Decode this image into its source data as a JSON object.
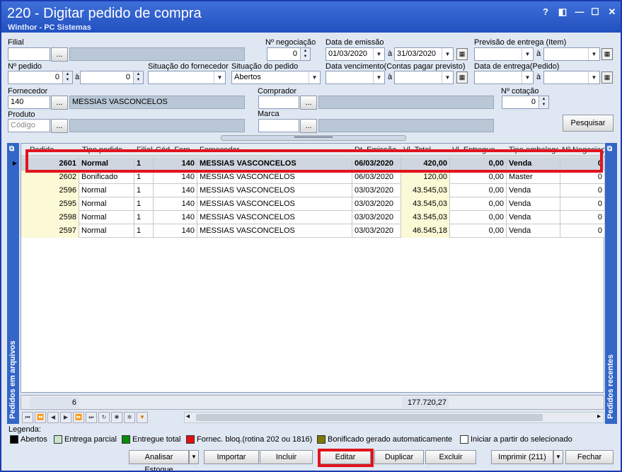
{
  "window": {
    "title": "220 - Digitar pedido de compra",
    "subtitle": "Winthor - PC Sistemas",
    "controls": [
      "?",
      "◧",
      "—",
      "☐",
      "✕"
    ]
  },
  "filters": {
    "filial_label": "Filial",
    "negociacao_label": "Nº negociação",
    "negociacao_value": "0",
    "emissao_label": "Data de emissão",
    "emissao_from": "01/03/2020",
    "emissao_to": "31/03/2020",
    "a_label": "à",
    "previsao_label": "Previsão  de entrega (Item)",
    "pedido_label": "Nº pedido",
    "pedido_from": "0",
    "pedido_to": "0",
    "sit_fornecedor_label": "Situação do fornecedor",
    "sit_pedido_label": "Situação do pedido",
    "sit_pedido_value": "Abertos",
    "vencimento_label": "Data vencimento(Contas pagar previsto)",
    "entrega_label": "Data de entrega(Pedido)",
    "fornecedor_label": "Fornecedor",
    "fornecedor_code": "140",
    "fornecedor_name": "MESSIAS VASCONCELOS",
    "comprador_label": "Comprador",
    "cotacao_label": "Nº cotação",
    "cotacao_value": "0",
    "produto_label": "Produto",
    "produto_placeholder": "Código",
    "marca_label": "Marca",
    "ellipsis": "...",
    "search_button": "Pesquisar"
  },
  "grid": {
    "columns": [
      "Pedido",
      "Tipo pedido",
      "Filial",
      "Cód. Forn.",
      "Fornecedor",
      "Dt. Emissão",
      "Vl. Total",
      "Vl. Entregue",
      "Tipo embalagem",
      "Nº Negociação"
    ],
    "rows": [
      {
        "pedido": "2601",
        "tipo": "Normal",
        "filial": "1",
        "cod": "140",
        "fornecedor": "MESSIAS VASCONCELOS",
        "emissao": "06/03/2020",
        "total": "420,00",
        "entregue": "0,00",
        "embalagem": "Venda",
        "neg": "0"
      },
      {
        "pedido": "2602",
        "tipo": "Bonificado",
        "filial": "1",
        "cod": "140",
        "fornecedor": "MESSIAS VASCONCELOS",
        "emissao": "06/03/2020",
        "total": "120,00",
        "entregue": "0,00",
        "embalagem": "Master",
        "neg": "0"
      },
      {
        "pedido": "2596",
        "tipo": "Normal",
        "filial": "1",
        "cod": "140",
        "fornecedor": "MESSIAS VASCONCELOS",
        "emissao": "03/03/2020",
        "total": "43.545,03",
        "entregue": "0,00",
        "embalagem": "Venda",
        "neg": "0"
      },
      {
        "pedido": "2595",
        "tipo": "Normal",
        "filial": "1",
        "cod": "140",
        "fornecedor": "MESSIAS VASCONCELOS",
        "emissao": "03/03/2020",
        "total": "43.545,03",
        "entregue": "0,00",
        "embalagem": "Venda",
        "neg": "0"
      },
      {
        "pedido": "2598",
        "tipo": "Normal",
        "filial": "1",
        "cod": "140",
        "fornecedor": "MESSIAS VASCONCELOS",
        "emissao": "03/03/2020",
        "total": "43.545,03",
        "entregue": "0,00",
        "embalagem": "Venda",
        "neg": "0"
      },
      {
        "pedido": "2597",
        "tipo": "Normal",
        "filial": "1",
        "cod": "140",
        "fornecedor": "MESSIAS VASCONCELOS",
        "emissao": "03/03/2020",
        "total": "46.545,18",
        "entregue": "0,00",
        "embalagem": "Venda",
        "neg": "0"
      }
    ],
    "footer_count": "6",
    "footer_total": "177.720,27"
  },
  "side_panels": {
    "left": "Pedidos em arquivos",
    "right": "Pedidos recentes"
  },
  "legend": {
    "title": "Legenda:",
    "items": [
      {
        "label": "Abertos",
        "color": "#000000"
      },
      {
        "label": "Entrega parcial",
        "color": "#c8e6c8"
      },
      {
        "label": "Entregue total",
        "color": "#0a8a0a"
      },
      {
        "label": "Fornec. bloq.(rotina 202 ou 1816)",
        "color": "#e01010"
      },
      {
        "label": "Bonificado gerado automaticamente",
        "color": "#7a7a00"
      },
      {
        "label": "Iniciar a partir do selecionado",
        "color": "#ffffff"
      }
    ]
  },
  "actions": {
    "analisar": "Analisar Estoque",
    "importar": "Importar",
    "incluir": "Incluir",
    "editar": "Editar",
    "duplicar": "Duplicar",
    "excluir": "Excluir",
    "imprimir": "Imprimir (211)",
    "fechar": "Fechar"
  }
}
